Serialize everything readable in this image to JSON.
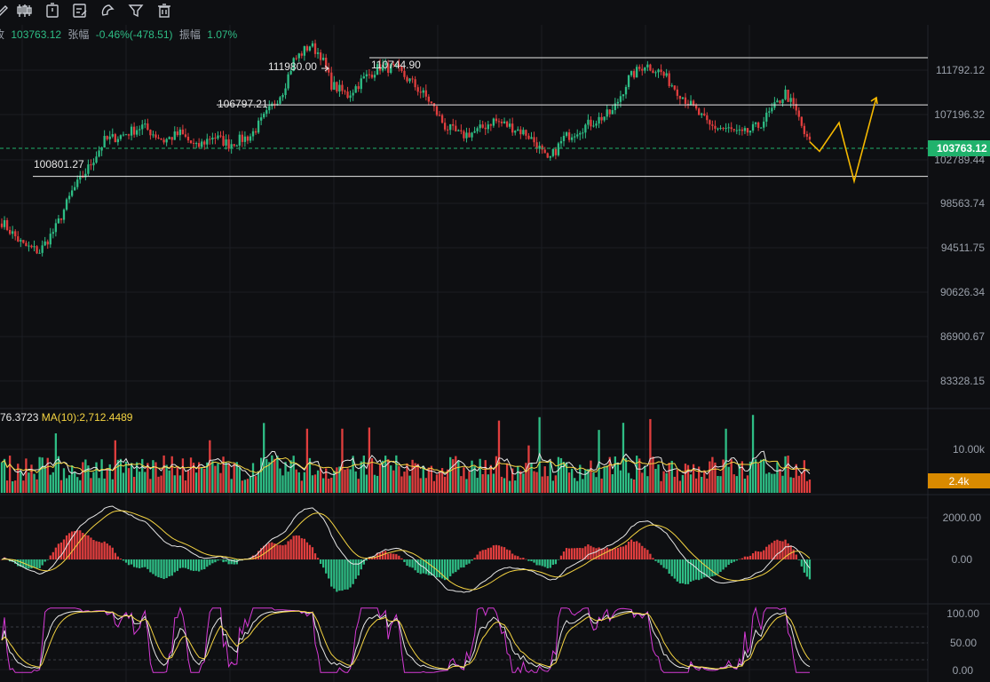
{
  "toolbar": {
    "icons": [
      "pen-icon",
      "candlestick-type-icon",
      "timer-icon",
      "note-edit-icon",
      "magnet-icon",
      "filter-icon",
      "trash-icon"
    ]
  },
  "info": {
    "close_label": "收",
    "close_value": "103763.12",
    "change_label": "张幅",
    "change_value": "-0.46%(-478.51)",
    "amplitude_label": "振幅",
    "amplitude_value": "1.07%"
  },
  "volume_info": {
    "ma5_value": "76.3723",
    "ma10_label": "MA(10):",
    "ma10_value": "2,712.4489"
  },
  "colors": {
    "up": "#2ebd85",
    "down": "#e03e3e",
    "ma_white": "#e6e6e6",
    "ma_yellow": "#f5d442",
    "macd_dif": "#e6e6e6",
    "macd_dea": "#f5d442",
    "kdj_j": "#d63ad6",
    "projection": "#f5b800",
    "price_tag": "#20b26c",
    "volume_tag": "#d98a00",
    "grid": "#1c1e23",
    "background": "#0e0f12"
  },
  "chart_data": {
    "type": "candlestick",
    "title": "",
    "price_axis": {
      "min": 81500,
      "max": 113500,
      "ticks": [
        "111792.12",
        "107196.32",
        "102789.44",
        "98563.74",
        "94511.75",
        "90626.34",
        "86900.67",
        "83328.15"
      ]
    },
    "current_price": "103763.12",
    "annotations": [
      {
        "label": "111980.00",
        "type": "high-marker"
      },
      {
        "label": "110744.90",
        "type": "resistance-line",
        "price": 110744.9
      },
      {
        "label": "106797.21",
        "type": "support-line",
        "price": 106797.21
      },
      {
        "label": "100801.27",
        "type": "support-line",
        "price": 100801.27
      }
    ],
    "trend_anchors": [
      [
        0,
        97000
      ],
      [
        8,
        95000
      ],
      [
        14,
        94500
      ],
      [
        20,
        96500
      ],
      [
        26,
        99500
      ],
      [
        32,
        101500
      ],
      [
        38,
        103800
      ],
      [
        44,
        104200
      ],
      [
        52,
        105000
      ],
      [
        60,
        103800
      ],
      [
        66,
        104400
      ],
      [
        72,
        103200
      ],
      [
        78,
        104200
      ],
      [
        84,
        103500
      ],
      [
        92,
        104200
      ],
      [
        98,
        106000
      ],
      [
        104,
        108000
      ],
      [
        108,
        110500
      ],
      [
        114,
        111800
      ],
      [
        118,
        111000
      ],
      [
        122,
        108500
      ],
      [
        128,
        107600
      ],
      [
        134,
        109000
      ],
      [
        140,
        110000
      ],
      [
        146,
        109800
      ],
      [
        152,
        108600
      ],
      [
        158,
        107200
      ],
      [
        164,
        105000
      ],
      [
        170,
        104200
      ],
      [
        176,
        104600
      ],
      [
        182,
        105500
      ],
      [
        188,
        105000
      ],
      [
        194,
        104400
      ],
      [
        198,
        103500
      ],
      [
        202,
        102000
      ],
      [
        208,
        104000
      ],
      [
        214,
        104800
      ],
      [
        220,
        105500
      ],
      [
        226,
        106200
      ],
      [
        232,
        109000
      ],
      [
        238,
        110200
      ],
      [
        244,
        109500
      ],
      [
        250,
        108000
      ],
      [
        256,
        106500
      ],
      [
        262,
        105000
      ],
      [
        268,
        104800
      ],
      [
        274,
        104300
      ],
      [
        280,
        105000
      ],
      [
        286,
        106600
      ],
      [
        290,
        107800
      ],
      [
        294,
        106200
      ],
      [
        298,
        103800
      ]
    ],
    "volume_axis": {
      "ticks": [
        "10.00k"
      ],
      "current": "2.4k"
    },
    "macd_axis": {
      "ticks": [
        "2000.00",
        "0.00"
      ]
    },
    "kdj_axis": {
      "ticks": [
        "100.00",
        "50.00",
        "0.00"
      ]
    },
    "projection_path": [
      103700,
      102900,
      105300,
      100400,
      107400
    ]
  }
}
